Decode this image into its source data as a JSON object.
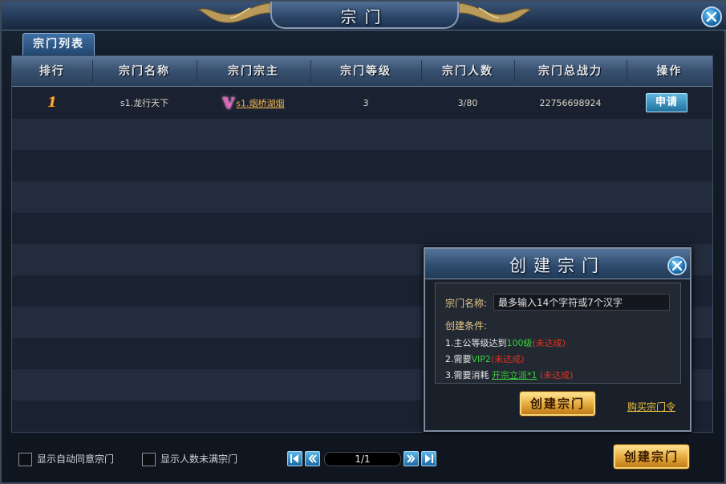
{
  "window": {
    "title": "宗门",
    "accent": "#2c4668"
  },
  "tabs": [
    {
      "label": "宗门列表",
      "active": true
    }
  ],
  "table": {
    "columns": [
      "排行",
      "宗门名称",
      "宗门宗主",
      "宗门等级",
      "宗门人数",
      "宗门总战力",
      "操作"
    ],
    "rows": [
      {
        "rank": "1",
        "sect_name": "s1.龙行天下",
        "leader_vip_icon": "vip-v-icon",
        "leader_name": "s1.烟桥湖烟",
        "level": "3",
        "members": "3/80",
        "power": "22756698924",
        "action_label": "申请"
      }
    ],
    "visible_row_count": 11
  },
  "footer": {
    "auto_accept_label": "显示自动同意宗门",
    "not_full_label": "显示人数未满宗门",
    "pager": {
      "page_text": "1/1",
      "icons": [
        "first-page-icon",
        "prev-page-icon",
        "next-page-icon",
        "last-page-icon"
      ]
    },
    "create_button_label": "创建宗门"
  },
  "create_dialog": {
    "title": "创建宗门",
    "name_label": "宗门名称:",
    "name_placeholder": "最多输入14个字符或7个汉字",
    "conditions_label": "创建条件:",
    "conditions": [
      {
        "prefix": "1.主公等级达到",
        "highlight": "100级",
        "status": "(未达成)"
      },
      {
        "prefix": "2.需要",
        "highlight": "VIP2",
        "status": "(未达成)"
      },
      {
        "prefix": "3.需要消耗 ",
        "highlight": "开宗立派*1",
        "status": "(未达成)"
      }
    ],
    "create_button_label": "创建宗门",
    "buy_link_label": "购买宗门令",
    "colors": {
      "met": "#3ad13a",
      "unmet": "#e2321f",
      "label": "#e8c98a"
    }
  }
}
